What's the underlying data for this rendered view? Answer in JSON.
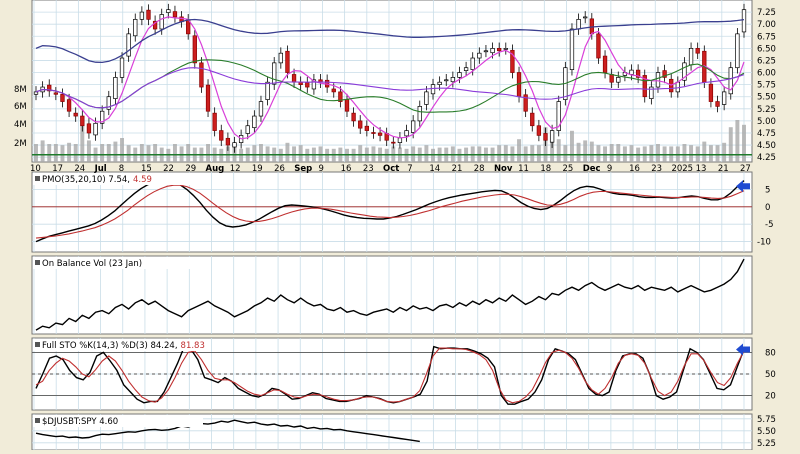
{
  "chart_data": {
    "type": "candlestick",
    "price": {
      "y_ticks": [
        "7.25",
        "7.00",
        "6.75",
        "6.50",
        "6.25",
        "6.00",
        "5.75",
        "5.50",
        "5.25",
        "5.00",
        "4.75",
        "4.50",
        "4.25"
      ],
      "volume_ticks": [
        "8M",
        "6M",
        "4M",
        "2M"
      ],
      "ylim": [
        4.15,
        7.5
      ],
      "x_labels": [
        "10",
        "17",
        "24",
        "Jul",
        "8",
        "15",
        "22",
        "29",
        "Aug",
        "12",
        "19",
        "26",
        "Sep",
        "9",
        "16",
        "23",
        "Oct",
        "7",
        "14",
        "21",
        "28",
        "Nov",
        "11",
        "18",
        "25",
        "Dec",
        "9",
        "16",
        "23",
        "2025",
        "13",
        "21",
        "27"
      ],
      "support_level": 4.3,
      "series": {
        "closes": [
          5.6,
          5.7,
          5.62,
          5.55,
          5.4,
          5.2,
          5.1,
          4.9,
          4.75,
          4.95,
          5.2,
          5.5,
          5.9,
          6.3,
          6.8,
          7.1,
          7.25,
          7.1,
          6.9,
          7.2,
          7.3,
          7.15,
          7.05,
          6.8,
          6.2,
          5.7,
          5.2,
          4.8,
          4.6,
          4.5,
          4.55,
          4.7,
          4.9,
          5.1,
          5.4,
          5.8,
          6.2,
          6.4,
          6.0,
          5.8,
          5.75,
          5.7,
          5.85,
          5.8,
          5.7,
          5.6,
          5.4,
          5.2,
          5.0,
          4.85,
          4.8,
          4.75,
          4.7,
          4.6,
          4.55,
          4.65,
          4.8,
          5.0,
          5.3,
          5.6,
          5.75,
          5.8,
          5.85,
          5.9,
          6.0,
          6.1,
          6.3,
          6.4,
          6.45,
          6.5,
          6.45,
          6.5,
          6.0,
          5.5,
          5.2,
          4.9,
          4.7,
          4.6,
          4.8,
          5.4,
          6.1,
          6.9,
          7.1,
          7.15,
          6.8,
          6.3,
          6.0,
          5.8,
          5.9,
          6.0,
          6.05,
          5.9,
          5.5,
          5.7,
          6.0,
          5.9,
          5.6,
          5.8,
          6.2,
          6.5,
          6.4,
          5.8,
          5.4,
          5.3,
          5.6,
          6.1,
          6.8,
          7.3
        ]
      }
    },
    "volume": {
      "values": [
        3,
        3.6,
        3,
        3,
        2.8,
        3.2,
        3,
        6,
        3.6,
        2.4,
        3,
        3,
        3.4,
        4,
        2.8,
        2.4,
        3,
        2.8,
        3,
        2.4,
        2.2,
        3,
        2.6,
        3,
        2.4,
        2.4,
        3,
        2.4,
        2.2,
        2.6,
        3,
        2.2,
        2.4,
        2.8,
        3,
        2.6,
        2.4,
        2.2,
        3.2,
        2.6,
        2.8,
        2.2,
        2.4,
        2.6,
        2.2,
        2.2,
        2.4,
        2.2,
        2.2,
        2.8,
        2.4,
        2.6,
        2.4,
        2.2,
        2.6,
        2.4,
        2.2,
        2.6,
        2.4,
        2.8,
        2.2,
        2.4,
        2.4,
        2.6,
        2.2,
        2.4,
        2.6,
        2.6,
        2.4,
        2.4,
        2.8,
        2.8,
        2.6,
        3.8,
        2.6,
        2.8,
        2.8,
        5.8,
        4.8,
        3.8,
        2.8,
        5.2,
        3.2,
        3.6,
        3.4,
        2.8,
        2.6,
        3,
        3,
        2.6,
        2.8,
        2.4,
        2.6,
        2.8,
        3,
        2.6,
        2.6,
        2.6,
        3,
        2.8,
        2.6,
        3.4,
        2.8,
        2.8,
        3.2,
        5.8,
        7,
        6.2
      ]
    },
    "panels": [
      {
        "name": "pmo",
        "label": "PMO(35,20,10) 7.54,",
        "value2": "4.59",
        "y_ticks": [
          "5",
          "0",
          "-5",
          "-10"
        ],
        "ylim": [
          -13,
          10
        ],
        "reference_lines": [
          0
        ],
        "series": [
          {
            "role": "main",
            "values": [
              -10,
              -9.2,
              -8.5,
              -8,
              -7.5,
              -7,
              -6.5,
              -6,
              -5.5,
              -4.8,
              -3.8,
              -2.6,
              -1.2,
              0.5,
              2.2,
              3.8,
              5.2,
              6.3,
              7,
              7.4,
              7.5,
              7.1,
              6.3,
              5,
              3.3,
              1.3,
              -1,
              -3,
              -4.6,
              -5.5,
              -5.8,
              -5.6,
              -5.2,
              -4.5,
              -3.6,
              -2.5,
              -1.4,
              -0.4,
              0.3,
              0.5,
              0.4,
              0.2,
              0,
              -0.3,
              -0.7,
              -1.2,
              -1.8,
              -2.4,
              -2.8,
              -3.1,
              -3.3,
              -3.4,
              -3.5,
              -3.5,
              -3.2,
              -2.8,
              -2.2,
              -1.5,
              -0.8,
              0,
              0.8,
              1.5,
              2.1,
              2.6,
              3,
              3.4,
              3.7,
              4,
              4.3,
              4.5,
              4.7,
              4.6,
              3.8,
              2.5,
              1.2,
              0.2,
              -0.5,
              -0.8,
              -0.5,
              0.5,
              1.8,
              3.3,
              4.6,
              5.5,
              5.9,
              5.7,
              5.1,
              4.4,
              3.9,
              3.6,
              3.5,
              3.3,
              2.9,
              2.7,
              2.7,
              2.8,
              2.6,
              2.5,
              2.6,
              2.9,
              3.1,
              2.9,
              2.4,
              2.0,
              2.0,
              2.6,
              4.0,
              5.8,
              7.54
            ]
          },
          {
            "role": "signal",
            "values": [
              -9,
              -8.8,
              -8.6,
              -8.4,
              -8.1,
              -7.8,
              -7.4,
              -7,
              -6.5,
              -6,
              -5.3,
              -4.5,
              -3.5,
              -2.3,
              -1,
              0.5,
              1.9,
              3.2,
              4.3,
              5.2,
              5.9,
              6.2,
              6.2,
              5.8,
              5,
              3.9,
              2.5,
              1,
              -0.4,
              -1.7,
              -2.8,
              -3.6,
              -4.1,
              -4.3,
              -4.2,
              -3.9,
              -3.4,
              -2.8,
              -2.1,
              -1.5,
              -1,
              -0.6,
              -0.4,
              -0.4,
              -0.5,
              -0.7,
              -1,
              -1.4,
              -1.8,
              -2.1,
              -2.4,
              -2.7,
              -2.9,
              -3,
              -3.1,
              -3,
              -2.8,
              -2.5,
              -2.1,
              -1.6,
              -1.1,
              -0.5,
              0.1,
              0.6,
              1.1,
              1.6,
              2,
              2.4,
              2.8,
              3.1,
              3.4,
              3.6,
              3.6,
              3.4,
              2.9,
              2.3,
              1.6,
              1,
              0.5,
              0.4,
              0.7,
              1.3,
              2.1,
              3,
              3.7,
              4.2,
              4.4,
              4.4,
              4.2,
              4,
              3.8,
              3.6,
              3.4,
              3.2,
              3,
              2.9,
              2.8,
              2.7,
              2.7,
              2.7,
              2.8,
              2.8,
              2.7,
              2.5,
              2.4,
              2.5,
              3,
              3.8,
              4.59
            ]
          }
        ],
        "arrow_at_value": 5.9
      },
      {
        "name": "obv",
        "label": "On Balance Vol (23 Jan)",
        "ylim": [
          0,
          1
        ],
        "series": [
          {
            "role": "main",
            "values": [
              0.05,
              0.1,
              0.08,
              0.14,
              0.12,
              0.2,
              0.16,
              0.24,
              0.2,
              0.28,
              0.3,
              0.26,
              0.34,
              0.38,
              0.32,
              0.4,
              0.44,
              0.38,
              0.42,
              0.36,
              0.3,
              0.26,
              0.22,
              0.3,
              0.34,
              0.38,
              0.42,
              0.36,
              0.32,
              0.28,
              0.22,
              0.26,
              0.3,
              0.36,
              0.4,
              0.46,
              0.42,
              0.5,
              0.44,
              0.4,
              0.46,
              0.4,
              0.36,
              0.38,
              0.32,
              0.3,
              0.34,
              0.28,
              0.3,
              0.26,
              0.24,
              0.28,
              0.3,
              0.32,
              0.28,
              0.34,
              0.3,
              0.36,
              0.32,
              0.34,
              0.3,
              0.36,
              0.38,
              0.34,
              0.4,
              0.36,
              0.42,
              0.38,
              0.44,
              0.4,
              0.46,
              0.42,
              0.5,
              0.44,
              0.38,
              0.42,
              0.48,
              0.44,
              0.52,
              0.5,
              0.56,
              0.6,
              0.56,
              0.62,
              0.66,
              0.6,
              0.56,
              0.6,
              0.64,
              0.6,
              0.58,
              0.62,
              0.56,
              0.6,
              0.58,
              0.56,
              0.6,
              0.54,
              0.58,
              0.62,
              0.58,
              0.54,
              0.56,
              0.6,
              0.64,
              0.7,
              0.8,
              0.96
            ]
          }
        ]
      },
      {
        "name": "sto",
        "label": "Full STO %K(14,3) %D(3) 84.24,",
        "value2": "81.83",
        "y_ticks": [
          "80",
          "50",
          "20"
        ],
        "ylim": [
          0,
          100
        ],
        "reference_lines": [
          80,
          50,
          20
        ],
        "series": [
          {
            "role": "main",
            "values": [
              30,
              50,
              72,
              75,
              70,
              55,
              45,
              42,
              52,
              75,
              80,
              68,
              55,
              35,
              25,
              15,
              10,
              12,
              12,
              25,
              45,
              65,
              88,
              84,
              70,
              45,
              42,
              38,
              45,
              40,
              30,
              25,
              20,
              18,
              22,
              30,
              28,
              22,
              15,
              16,
              20,
              24,
              22,
              16,
              14,
              12,
              12,
              14,
              16,
              20,
              18,
              16,
              12,
              10,
              12,
              15,
              18,
              22,
              40,
              88,
              85,
              86,
              86,
              85,
              85,
              82,
              78,
              72,
              60,
              20,
              8,
              8,
              12,
              15,
              25,
              42,
              70,
              85,
              82,
              78,
              70,
              50,
              30,
              22,
              20,
              25,
              55,
              75,
              78,
              78,
              72,
              50,
              20,
              15,
              18,
              25,
              55,
              85,
              80,
              70,
              50,
              30,
              28,
              35,
              60,
              84.24
            ]
          },
          {
            "role": "signal",
            "values": [
              35,
              40,
              55,
              65,
              72,
              68,
              60,
              50,
              46,
              56,
              68,
              75,
              68,
              55,
              40,
              28,
              18,
              13,
              11,
              17,
              28,
              45,
              65,
              80,
              82,
              70,
              55,
              44,
              42,
              42,
              38,
              32,
              26,
              22,
              20,
              24,
              28,
              27,
              22,
              18,
              17,
              20,
              22,
              21,
              18,
              15,
              13,
              13,
              14,
              17,
              18,
              18,
              15,
              12,
              11,
              12,
              15,
              18,
              27,
              50,
              75,
              86,
              86,
              85,
              85,
              84,
              81,
              77,
              70,
              55,
              30,
              14,
              10,
              12,
              18,
              28,
              46,
              66,
              80,
              83,
              80,
              72,
              58,
              40,
              28,
              22,
              30,
              45,
              65,
              76,
              78,
              76,
              65,
              44,
              26,
              20,
              25,
              40,
              62,
              78,
              78,
              68,
              52,
              38,
              34,
              45,
              65,
              81.83
            ]
          }
        ],
        "arrow_at_value": 84
      },
      {
        "name": "rel",
        "label": "$DJUSBT:SPY 4.60",
        "y_ticks": [
          "5.75",
          "5.50",
          "5.25"
        ],
        "ylim": [
          5.1,
          5.85
        ],
        "series": [
          {
            "role": "main",
            "values": [
              5.45,
              5.42,
              5.4,
              5.38,
              5.39,
              5.36,
              5.37,
              5.35,
              5.36,
              5.4,
              5.43,
              5.42,
              5.44,
              5.46,
              5.48,
              5.47,
              5.5,
              5.52,
              5.53,
              5.51,
              5.52,
              5.55,
              5.6,
              5.58,
              5.62,
              5.65,
              5.64,
              5.66,
              5.7,
              5.68,
              5.72,
              5.69,
              5.66,
              5.68,
              5.64,
              5.62,
              5.64,
              5.6,
              5.61,
              5.58,
              5.6,
              5.55,
              5.57,
              5.54,
              5.55,
              5.52,
              5.53,
              5.5,
              5.48,
              5.46,
              5.44,
              5.42,
              5.4,
              5.38,
              5.36,
              5.34,
              5.32,
              5.3,
              5.28
            ]
          }
        ]
      }
    ]
  }
}
